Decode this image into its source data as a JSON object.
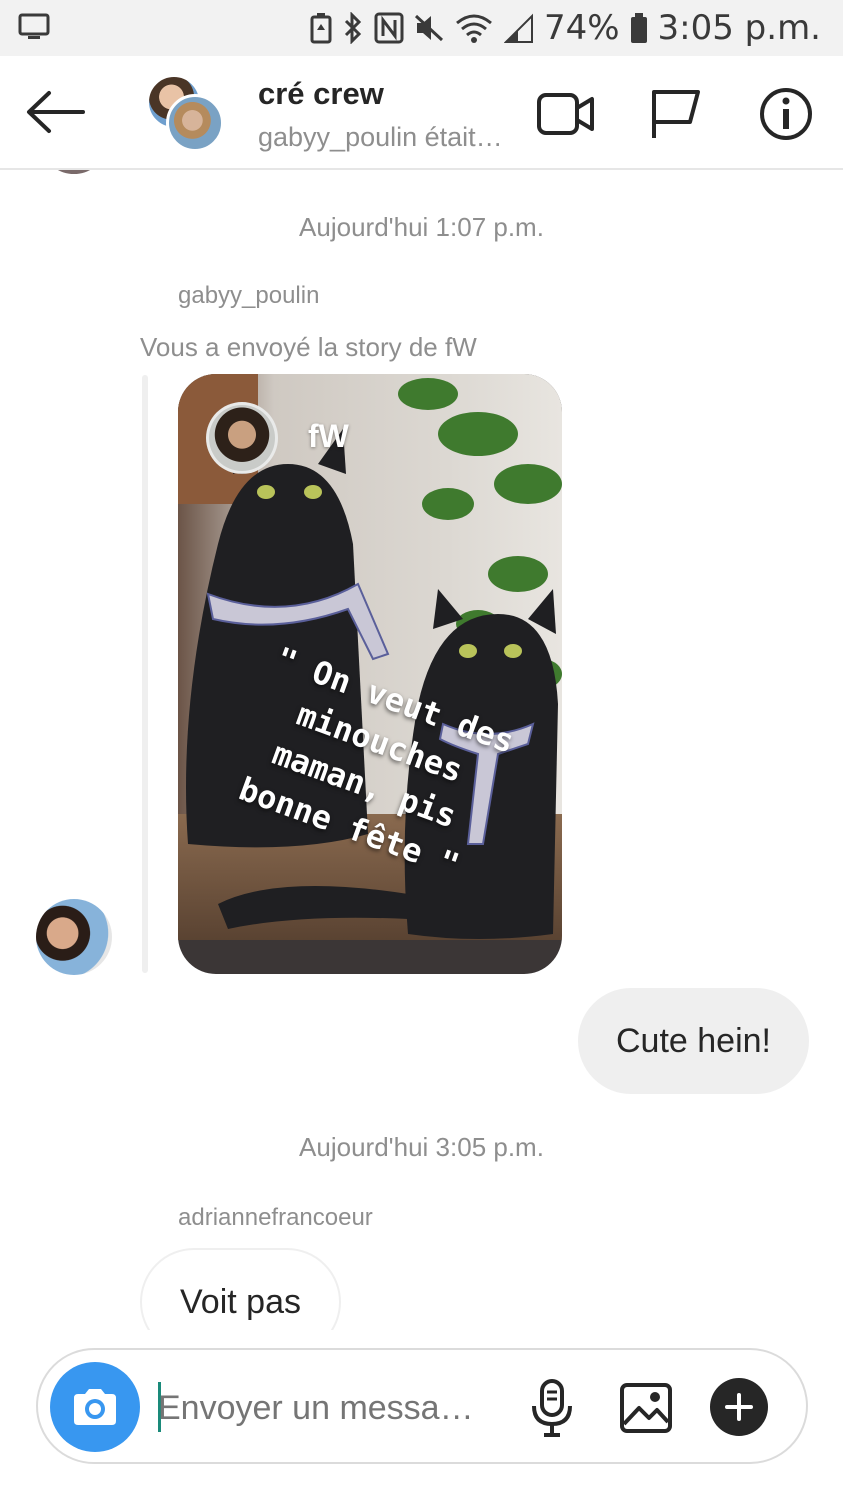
{
  "status_bar": {
    "battery_percent": "74%",
    "time": "3:05 p.m."
  },
  "header": {
    "title": "cré crew",
    "subtitle": "gabyy_poulin était en ligne"
  },
  "messages": {
    "timestamp_1": "Aujourd'hui 1:07 p.m.",
    "sender_1": "gabyy_poulin",
    "story_note": "Vous a envoyé la story de fW"
  },
  "story": {
    "owner": "fW",
    "caption_lines": [
      "\" On veut des",
      "minouches",
      "maman, pis",
      "bonne fête \""
    ]
  },
  "reply": {
    "text": "Cute hein!"
  },
  "later": {
    "timestamp_2": "Aujourd'hui 3:05 p.m.",
    "sender_2": "adriannefrancoeur",
    "message": "Voit pas"
  },
  "composer": {
    "placeholder": "Envoyer un messa…"
  },
  "icons": {
    "status": [
      "screen-icon",
      "battery-saver-icon",
      "bluetooth-icon",
      "nfc-icon",
      "mute-icon",
      "wifi-icon",
      "signal-icon",
      "battery-icon"
    ],
    "header": [
      "back-arrow-icon",
      "video-call-icon",
      "flag-icon",
      "info-icon"
    ],
    "composer": [
      "camera-icon",
      "microphone-icon",
      "gallery-icon",
      "plus-icon"
    ]
  },
  "colors": {
    "accent": "#3897f0",
    "bubble_gray": "#efefef",
    "meta_text": "#8e8e8e",
    "caret": "#1a8a7a"
  }
}
